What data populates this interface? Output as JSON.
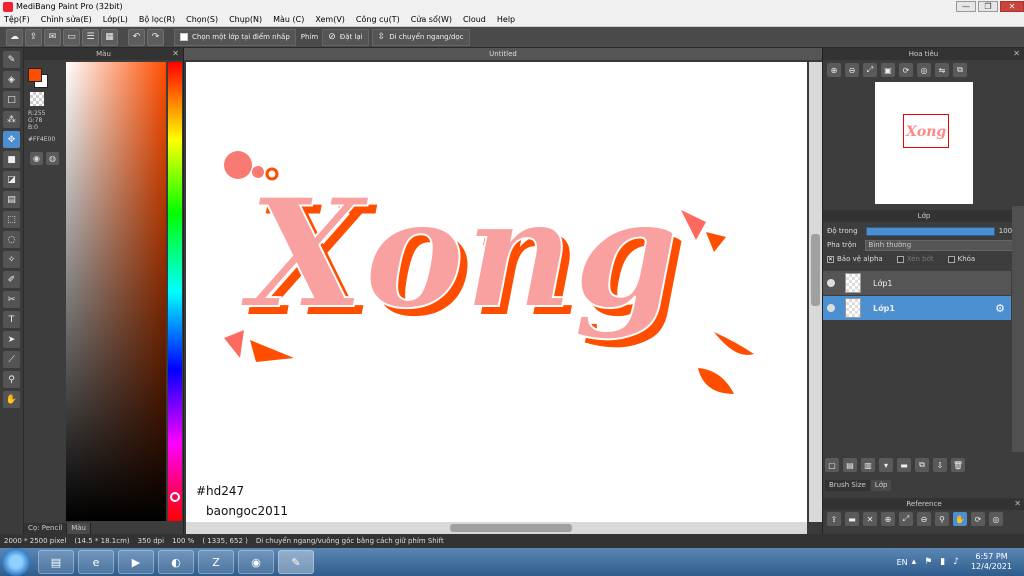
{
  "window": {
    "title": "MediBang Paint Pro (32bit)"
  },
  "menu": [
    "Tệp(F)",
    "Chỉnh sửa(E)",
    "Lớp(L)",
    "Bộ lọc(R)",
    "Chọn(S)",
    "Chụp(N)",
    "Màu (C)",
    "Xem(V)",
    "Công cụ(T)",
    "Cửa sổ(W)",
    "Cloud",
    "Help"
  ],
  "toolbar": {
    "select_layer_label": "Chọn một lớp tại điểm nhấp",
    "key_label": "Phím",
    "reset_label": "Đặt lại",
    "move_label": "Di chuyển ngang/dọc"
  },
  "color_panel": {
    "title": "Màu",
    "rgb": [
      "R:255",
      "G:78",
      "B:0"
    ],
    "hex": "#FF4E00",
    "colors": {
      "foreground": "#ff4e00",
      "background": "#ffffff"
    },
    "tabs": [
      "Cọ: Pencil",
      "Màu"
    ]
  },
  "document": {
    "tab": "Untitled",
    "artwork_text": "Xong",
    "watermark_line1": "#hd247",
    "watermark_line2": "baongoc2011"
  },
  "navigator": {
    "title": "Hoa tiêu"
  },
  "layers": {
    "title": "Lớp",
    "opacity_label": "Độ trong",
    "opacity_value": "100 %",
    "opacity_fraction": 1.0,
    "blend_label": "Pha trộn",
    "blend_value": "Bình thường",
    "protect_alpha": "Bảo vệ alpha",
    "clip": "Xén bớt",
    "lock": "Khóa",
    "items": [
      {
        "name": "Lớp1",
        "selected": false
      },
      {
        "name": "Lớp1",
        "selected": true
      }
    ],
    "tabs": [
      "Brush Size",
      "Lớp"
    ]
  },
  "reference": {
    "title": "Reference"
  },
  "status": {
    "size": "2000 * 2500 pixel",
    "dims": "(14.5 * 18.1cm)",
    "dpi": "350 dpi",
    "zoom": "100 %",
    "coords": "( 1335, 652 )",
    "hint": "Di chuyển ngang/vuông góc bằng cách giữ phím Shift"
  },
  "taskbar": {
    "lang": "EN",
    "time": "6:57 PM",
    "date": "12/4/2021"
  }
}
